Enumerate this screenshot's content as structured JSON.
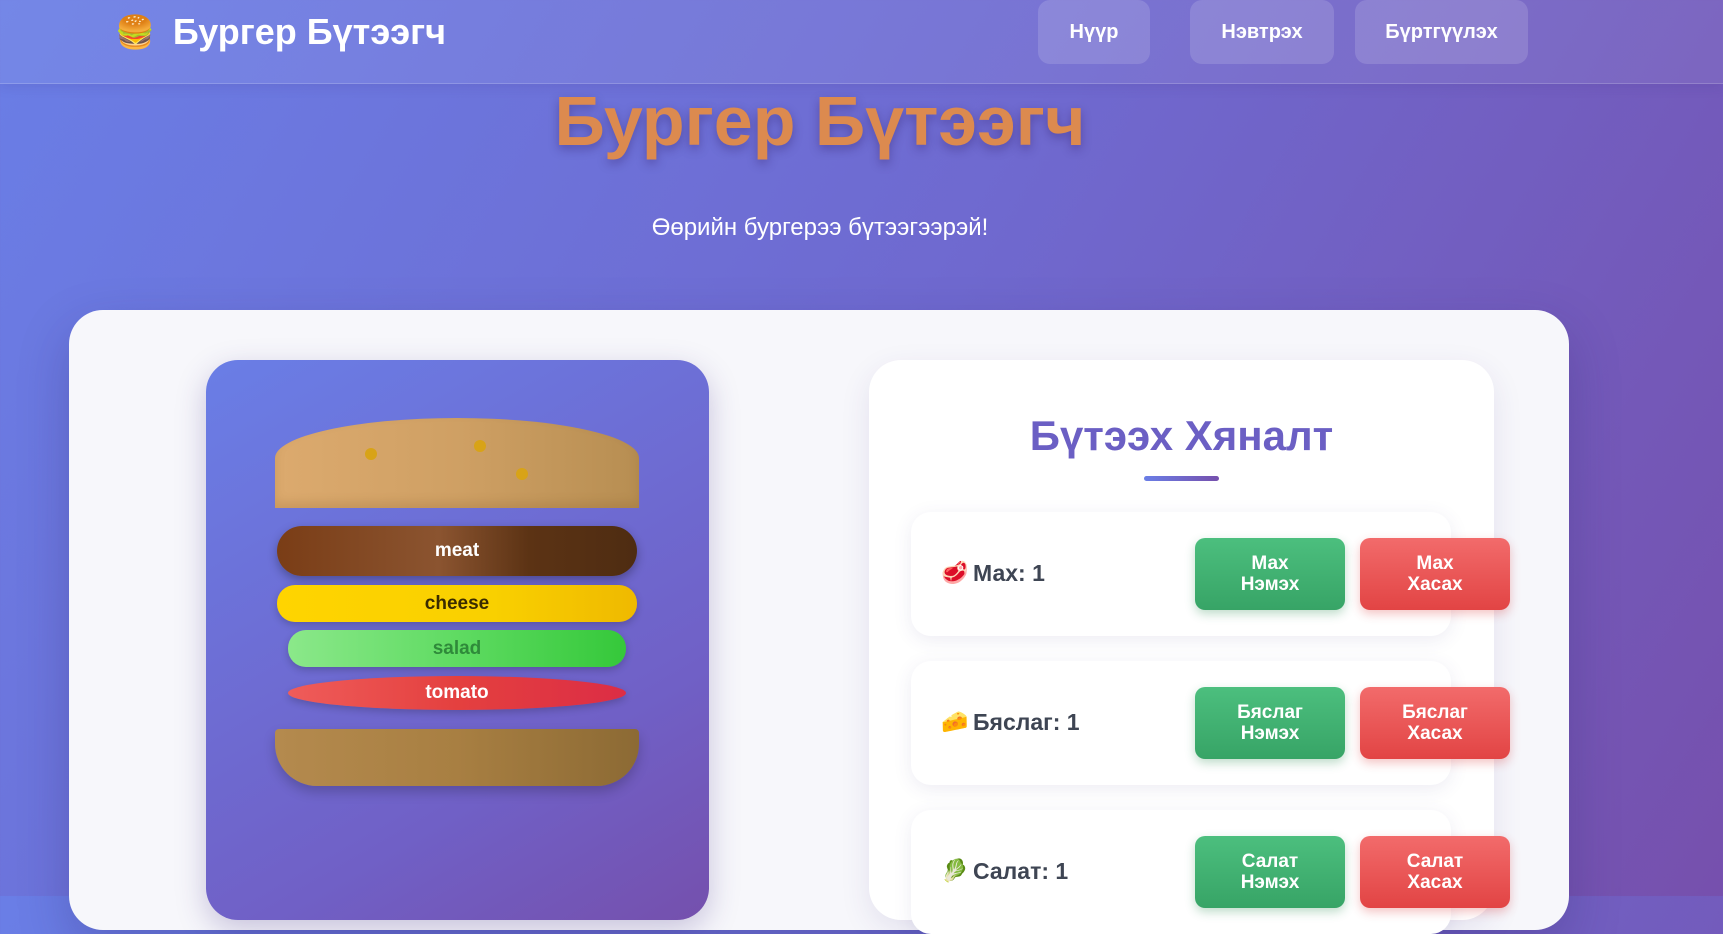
{
  "nav": {
    "brand_icon": "🍔",
    "brand_text": "Бургер Бүтээгч",
    "links": [
      "Нүүр",
      "Нэвтрэх",
      "Бүртгүүлэх"
    ]
  },
  "hero": {
    "title": "Бургер Бүтээгч",
    "subtitle": "Өөрийн бургерээ бүтээгээрэй!"
  },
  "burger": {
    "layers": {
      "meat": "meat",
      "cheese": "cheese",
      "salad": "salad",
      "tomato": "tomato"
    }
  },
  "controls": {
    "title": "Бүтээх Хяналт",
    "rows": [
      {
        "icon": "🥩",
        "label": "Мах: 1",
        "add": "Мах\nНэмэх",
        "remove": "Мах\nХасах"
      },
      {
        "icon": "🧀",
        "label": "Бяслаг: 1",
        "add": "Бяслаг\nНэмэх",
        "remove": "Бяслаг\nХасах"
      },
      {
        "icon": "🥬",
        "label": "Салат: 1",
        "add": "Салат\nНэмэх",
        "remove": "Салат\nХасах"
      }
    ]
  },
  "colors": {
    "accent": "#6b5fc4",
    "title_orange": "#dc8a4f",
    "add_green": "#3fae70",
    "remove_red": "#e85555"
  }
}
